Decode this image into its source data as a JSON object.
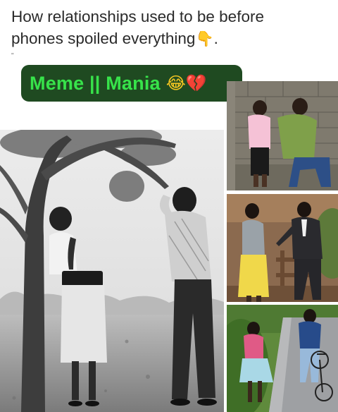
{
  "caption": {
    "line1": "How relationships used to be before",
    "line2": "phones spoiled everything",
    "pointer": "👇",
    "end": "."
  },
  "badge": {
    "text": "Meme || Mania",
    "emoji_laugh": "😂",
    "emoji_heart": "💔"
  },
  "photos": [
    {
      "id": "main-bw",
      "subject": "couple at tree, black and white"
    },
    {
      "id": "top-right",
      "subject": "couple by brick wall"
    },
    {
      "id": "mid-right",
      "subject": "couple at wooden fence"
    },
    {
      "id": "bottom-right",
      "subject": "couple by road with bicycle"
    }
  ]
}
